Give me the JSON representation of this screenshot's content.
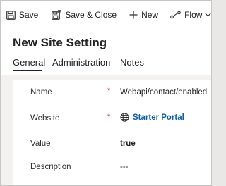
{
  "toolbar": {
    "save_label": "Save",
    "save_close_label": "Save & Close",
    "new_label": "New",
    "flow_label": "Flow"
  },
  "header": {
    "title": "New Site Setting"
  },
  "tabs": [
    {
      "label": "General",
      "selected": true
    },
    {
      "label": "Administration",
      "selected": false
    },
    {
      "label": "Notes",
      "selected": false
    }
  ],
  "form": {
    "fields": [
      {
        "label": "Name",
        "required_marker": "*",
        "value": "Webapi/contact/enabled"
      },
      {
        "label": "Website",
        "required_marker": "*",
        "value": "Starter Portal"
      },
      {
        "label": "Value",
        "value": "true"
      },
      {
        "label": "Description",
        "value": "---"
      }
    ]
  },
  "colors": {
    "link": "#115ea3",
    "required": "#a4262c",
    "text": "#242424"
  }
}
